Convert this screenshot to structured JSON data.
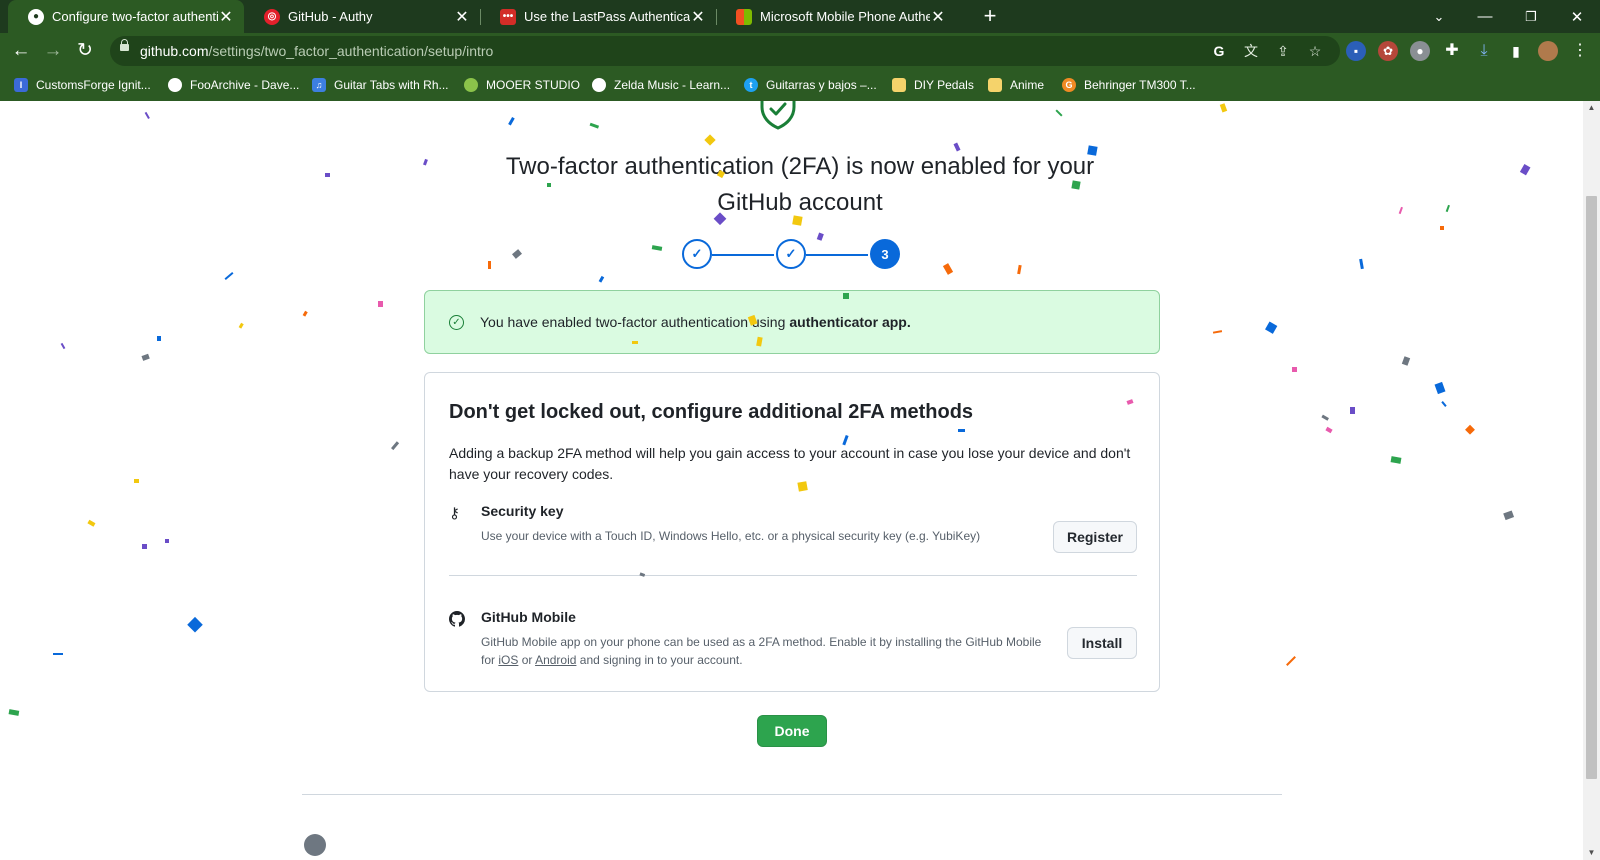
{
  "browser": {
    "tabs": [
      {
        "title": "Configure two-factor authenticat",
        "active": true
      },
      {
        "title": "GitHub - Authy",
        "active": false
      },
      {
        "title": "Use the LastPass Authenticator ap",
        "active": false
      },
      {
        "title": "Microsoft Mobile Phone Authenti",
        "active": false
      }
    ],
    "url_host": "github.com",
    "url_path": "/settings/two_factor_authentication/setup/intro",
    "bookmarks": [
      {
        "label": "CustomsForge Ignit...",
        "icon_color": "#3b6ad8",
        "icon_glyph": "I"
      },
      {
        "label": "FooArchive - Dave...",
        "icon_color": "#ffffff",
        "icon_glyph": ""
      },
      {
        "label": "Guitar Tabs with Rh...",
        "icon_color": "#3d7fe0",
        "icon_glyph": "♫"
      },
      {
        "label": "MOOER STUDIO",
        "icon_color": "#8bc34a",
        "icon_glyph": ""
      },
      {
        "label": "Zelda Music - Learn...",
        "icon_color": "#ffffff",
        "icon_glyph": ""
      },
      {
        "label": "Guitarras y bajos –...",
        "icon_color": "#1da1f2",
        "icon_glyph": "t"
      },
      {
        "label": "DIY Pedals",
        "icon_color": "#f5d36b",
        "icon_glyph": ""
      },
      {
        "label": "Anime",
        "icon_color": "#f5d36b",
        "icon_glyph": ""
      },
      {
        "label": "Behringer TM300 T...",
        "icon_color": "#f08a24",
        "icon_glyph": "G"
      }
    ]
  },
  "page": {
    "headline": "Two-factor authentication (2FA) is now enabled for your GitHub account",
    "steps": [
      {
        "state": "done",
        "label": "✓"
      },
      {
        "state": "done",
        "label": "✓"
      },
      {
        "state": "current",
        "label": "3"
      }
    ],
    "flash": {
      "text": "You have enabled two-factor authentication using",
      "method": "authenticator app."
    },
    "card": {
      "title": "Don't get locked out, configure additional 2FA methods",
      "description": "Adding a backup 2FA method will help you gain access to your account in case you lose your device and don't have your recovery codes.",
      "security_key": {
        "title": "Security key",
        "text": "Use your device with a Touch ID, Windows Hello, etc. or a physical security key (e.g. YubiKey)",
        "button": "Register"
      },
      "github_mobile": {
        "title": "GitHub Mobile",
        "text_before": "GitHub Mobile app on your phone can be used as a 2FA method. Enable it by installing the GitHub Mobile for",
        "ios_link": "iOS",
        "or": "or",
        "android_link": "Android",
        "text_after": "and signing in to your account.",
        "button": "Install"
      }
    },
    "done_button": "Done"
  },
  "colors": {
    "chrome_dark": "#1e3a1e",
    "chrome": "#2c5a23",
    "accent_blue": "#0969da",
    "success_green": "#2da44e",
    "flash_bg": "#dafbe1"
  }
}
